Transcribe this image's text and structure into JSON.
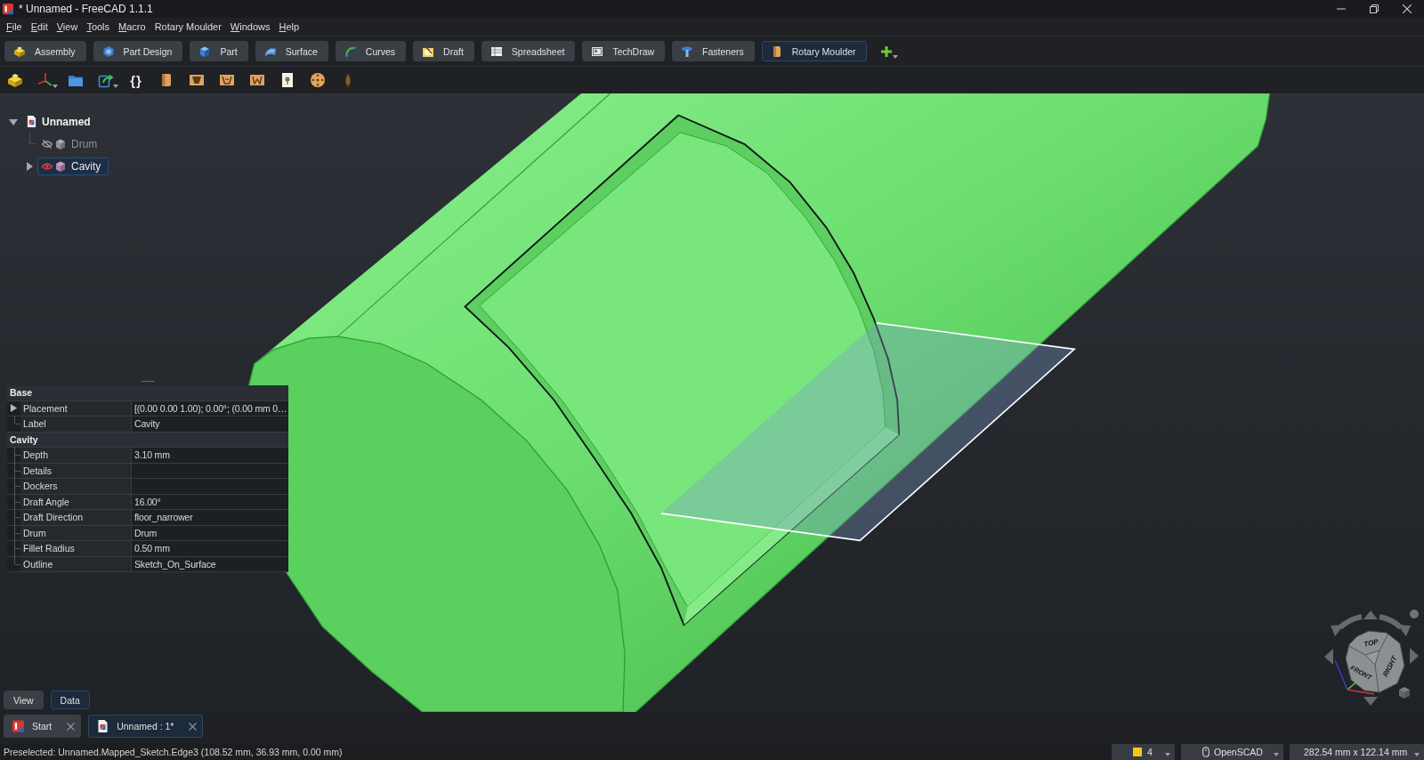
{
  "window": {
    "title": "* Unnamed - FreeCAD 1.1.1"
  },
  "menu": [
    {
      "label": "File",
      "mnemonic": true
    },
    {
      "label": "Edit",
      "mnemonic": true
    },
    {
      "label": "View",
      "mnemonic": true
    },
    {
      "label": "Tools",
      "mnemonic": true
    },
    {
      "label": "Macro",
      "mnemonic": true
    },
    {
      "label": "Rotary Moulder",
      "mnemonic": false
    },
    {
      "label": "Windows",
      "mnemonic": true
    },
    {
      "label": "Help",
      "mnemonic": true
    }
  ],
  "workbenches": [
    {
      "label": "Assembly",
      "kind": "assembly",
      "selected": false
    },
    {
      "label": "Part Design",
      "kind": "partdesign",
      "selected": false
    },
    {
      "label": "Part",
      "kind": "part",
      "selected": false
    },
    {
      "label": "Surface",
      "kind": "surface",
      "selected": false
    },
    {
      "label": "Curves",
      "kind": "curves",
      "selected": false
    },
    {
      "label": "Draft",
      "kind": "draft",
      "selected": false
    },
    {
      "label": "Spreadsheet",
      "kind": "spreadsheet",
      "selected": false
    },
    {
      "label": "TechDraw",
      "kind": "techdraw",
      "selected": false
    },
    {
      "label": "Fasteners",
      "kind": "fasteners",
      "selected": false
    },
    {
      "label": "Rotary Moulder",
      "kind": "rotary",
      "selected": true
    }
  ],
  "toolbar": [
    {
      "kind": "boxes",
      "dropdown": false
    },
    {
      "kind": "axes",
      "dropdown": true
    },
    {
      "kind": "folder",
      "dropdown": false
    },
    {
      "kind": "export",
      "dropdown": true
    },
    {
      "kind": "glyph",
      "glyph": "{}",
      "dropdown": false
    },
    {
      "kind": "drum",
      "dropdown": false
    },
    {
      "kind": "trapezoid",
      "dropdown": false
    },
    {
      "kind": "recess",
      "dropdown": false
    },
    {
      "kind": "notch",
      "dropdown": false
    },
    {
      "kind": "sheet",
      "dropdown": false
    },
    {
      "kind": "disc",
      "dropdown": false
    },
    {
      "kind": "cone",
      "dropdown": false
    }
  ],
  "tree": {
    "label": "Unnamed",
    "expanded": true,
    "selected": false,
    "children": [
      {
        "label": "Drum",
        "visible": false,
        "selected": false,
        "color": "#8e9094"
      },
      {
        "label": "Cavity",
        "visible": true,
        "selected": true,
        "expanded": false,
        "color": "#b784b3"
      }
    ]
  },
  "properties": [
    {
      "group": "Base",
      "rows": [
        {
          "name": "Placement",
          "value": "[(0.00 0.00 1.00); 0.00°; (0.00 mm  0…",
          "expanded": false
        },
        {
          "name": "Label",
          "value": "Cavity"
        }
      ]
    },
    {
      "group": "Cavity",
      "rows": [
        {
          "name": "Depth",
          "value": "3.10 mm"
        },
        {
          "name": "Details"
        },
        {
          "name": "Dockers"
        },
        {
          "name": "Draft Angle",
          "value": "16.00°"
        },
        {
          "name": "Draft Direction",
          "value": "floor_narrower"
        },
        {
          "name": "Drum",
          "value": "Drum"
        },
        {
          "name": "Fillet Radius",
          "value": "0.50 mm"
        },
        {
          "name": "Outline",
          "value": "Sketch_On_Surface"
        }
      ]
    }
  ],
  "panel_tabs": [
    {
      "label": "View",
      "selected": false
    },
    {
      "label": "Data",
      "selected": true
    }
  ],
  "nav_cube": {
    "faces": [
      "TOP",
      "FRONT",
      "RIGHT"
    ]
  },
  "doc_tabs": [
    {
      "label": "Start",
      "kind": "start",
      "selected": false
    },
    {
      "label": "Unnamed : 1*",
      "kind": "document",
      "selected": true
    }
  ],
  "status_bar": {
    "message": "Preselected: Unnamed.Mapped_Sketch.Edge3 (108.52 mm, 36.93 mm, 0.00 mm)",
    "widgets": [
      {
        "kind": "swatch",
        "text": "4"
      },
      {
        "kind": "mouse",
        "text": "OpenSCAD"
      },
      {
        "kind": "plain",
        "text": "282.54 mm x 122.14 mm"
      }
    ]
  }
}
